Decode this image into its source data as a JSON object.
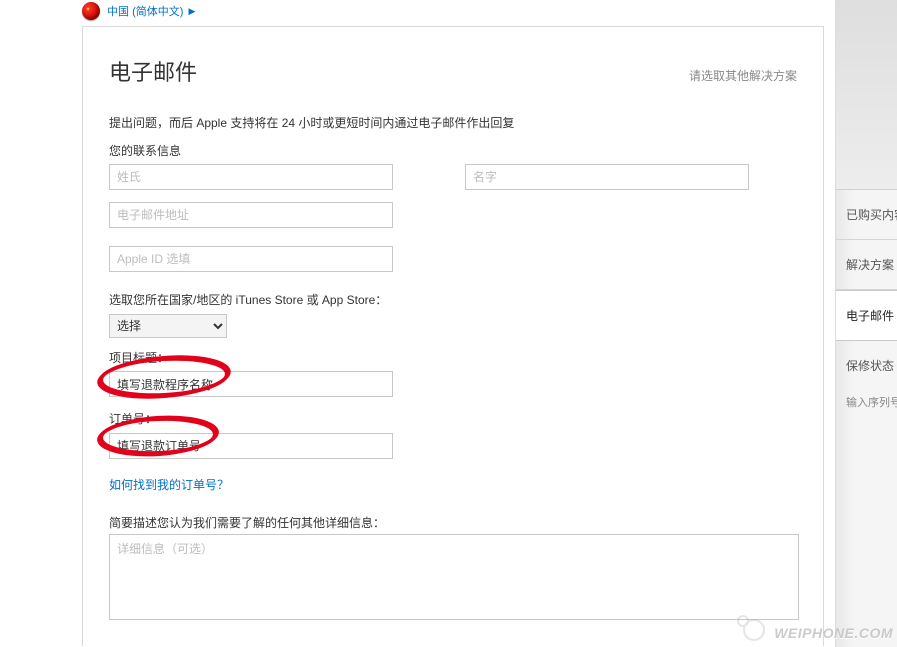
{
  "topbar": {
    "region": "中国 (简体中文)"
  },
  "page": {
    "title": "电子邮件",
    "alt_solution": "请选取其他解决方案"
  },
  "intro": "提出问题，而后 Apple 支持将在 24 小时或更短时间内通过电子邮件作出回复",
  "contact": {
    "heading": "您的联系信息",
    "surname_placeholder": "姓氏",
    "givenname_placeholder": "名字",
    "email_placeholder": "电子邮件地址",
    "appleid_placeholder": "Apple ID 选填"
  },
  "store": {
    "label": "选取您所在国家/地区的 iTunes Store 或 App Store：",
    "selected": "选择"
  },
  "project": {
    "title_label": "项目标题：",
    "title_value": "填写退款程序名称"
  },
  "order": {
    "label": "订单号：",
    "value": "填写退款订单号"
  },
  "find_order_link": "如何找到我的订单号？",
  "description": {
    "label": "简要描述您认为我们需要了解的任何其他详细信息：",
    "placeholder": "详细信息（可选）"
  },
  "sidebar": {
    "items": [
      {
        "label": "已购买内容"
      },
      {
        "label": "解决方案"
      },
      {
        "label": "电子邮件",
        "active": true
      },
      {
        "label": "保修状态",
        "sub": "输入序列号"
      }
    ]
  },
  "watermark": "WEIPHONE.COM"
}
